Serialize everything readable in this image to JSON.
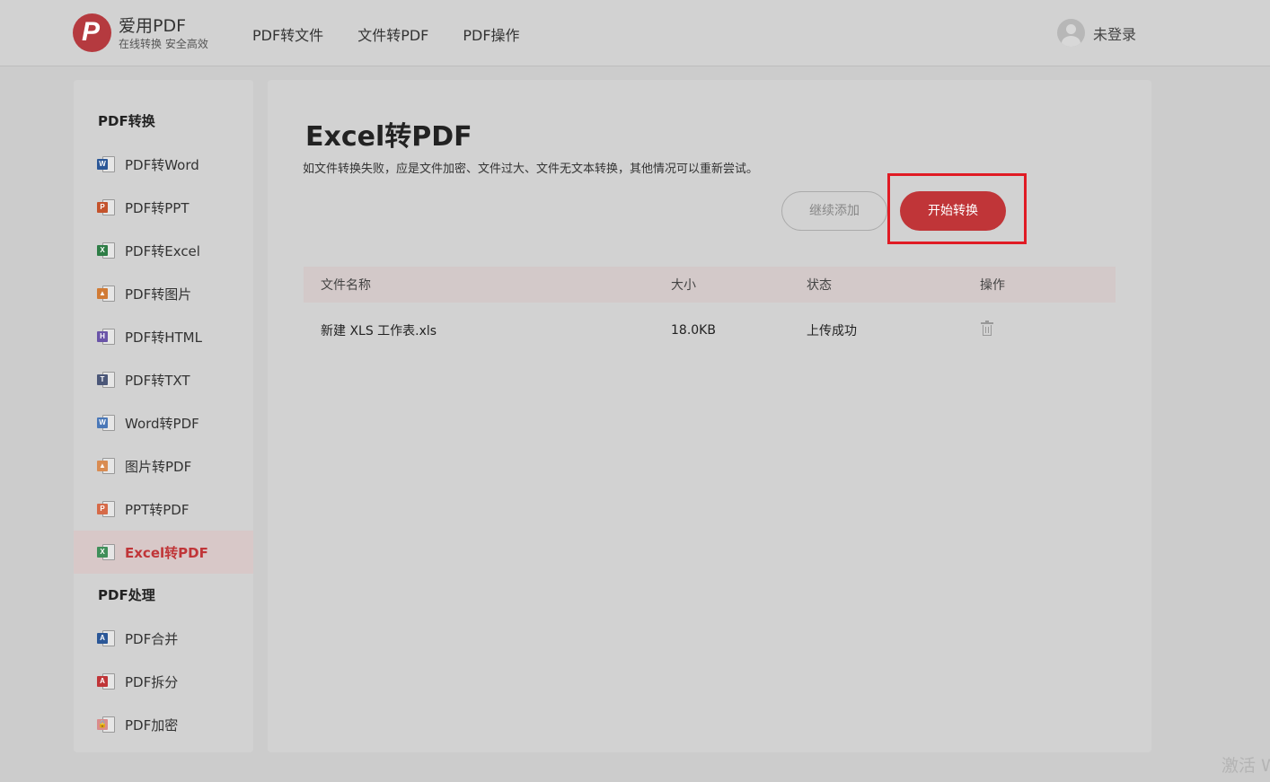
{
  "header": {
    "logo_title": "爱用PDF",
    "logo_subtitle": "在线转换 安全高效",
    "nav": [
      "PDF转文件",
      "文件转PDF",
      "PDF操作"
    ],
    "user_label": "未登录"
  },
  "sidebar": {
    "group1": "PDF转换",
    "items1": [
      {
        "label": "PDF转Word",
        "icon": "word-file-icon",
        "tag": "W",
        "color": "#2b5797"
      },
      {
        "label": "PDF转PPT",
        "icon": "ppt-file-icon",
        "tag": "P",
        "color": "#c4532c"
      },
      {
        "label": "PDF转Excel",
        "icon": "excel-file-icon",
        "tag": "X",
        "color": "#2e7d46"
      },
      {
        "label": "PDF转图片",
        "icon": "image-file-icon",
        "tag": "▲",
        "color": "#d17b35"
      },
      {
        "label": "PDF转HTML",
        "icon": "html-file-icon",
        "tag": "H",
        "color": "#6a54a8"
      },
      {
        "label": "PDF转TXT",
        "icon": "txt-file-icon",
        "tag": "T",
        "color": "#4b5778"
      },
      {
        "label": "Word转PDF",
        "icon": "word-to-pdf-icon",
        "tag": "W",
        "color": "#4a78b8"
      },
      {
        "label": "图片转PDF",
        "icon": "image-to-pdf-icon",
        "tag": "▲",
        "color": "#d98c52"
      },
      {
        "label": "PPT转PDF",
        "icon": "ppt-to-pdf-icon",
        "tag": "P",
        "color": "#d66a48"
      },
      {
        "label": "Excel转PDF",
        "icon": "excel-to-pdf-icon",
        "tag": "X",
        "color": "#3f8f5a",
        "active": true
      }
    ],
    "group2": "PDF处理",
    "items2": [
      {
        "label": "PDF合并",
        "icon": "pdf-merge-icon",
        "tag": "A",
        "color": "#2b5797"
      },
      {
        "label": "PDF拆分",
        "icon": "pdf-split-icon",
        "tag": "A",
        "color": "#c03538"
      },
      {
        "label": "PDF加密",
        "icon": "pdf-encrypt-icon",
        "tag": "🔒",
        "color": "#d98c8c"
      }
    ]
  },
  "main": {
    "title": "Excel转PDF",
    "tip": "如文件转换失败，应是文件加密、文件过大、文件无文本转换，其他情况可以重新尝试。",
    "add_button": "继续添加",
    "start_button": "开始转换",
    "table": {
      "headers": [
        "文件名称",
        "大小",
        "状态",
        "操作"
      ],
      "rows": [
        {
          "name": "新建 XLS 工作表.xls",
          "size": "18.0KB",
          "status": "上传成功"
        }
      ]
    }
  },
  "watermark": "激活 W"
}
